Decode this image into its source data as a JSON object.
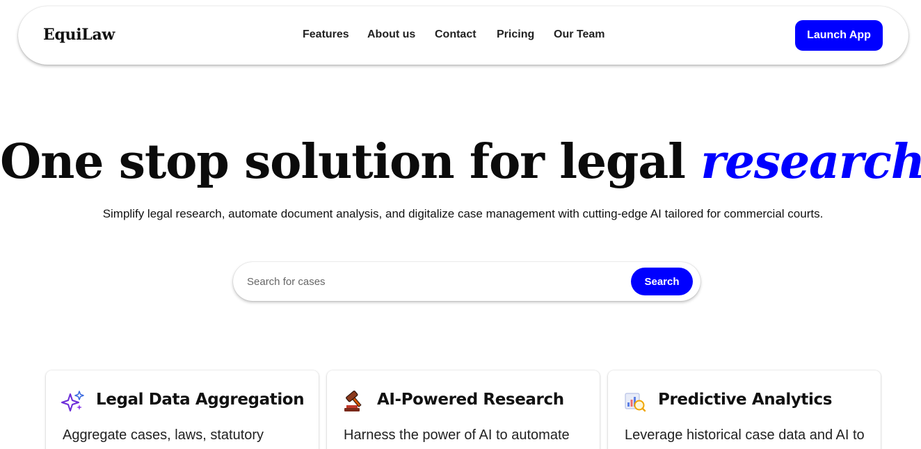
{
  "brand": {
    "name": "EquiLaw",
    "accent_color": "#0000ff"
  },
  "nav": {
    "items": [
      {
        "label": "Features"
      },
      {
        "label": "About us"
      },
      {
        "label": "Contact"
      },
      {
        "label": "Pricing"
      },
      {
        "label": "Our Team"
      }
    ],
    "cta_label": "Launch App"
  },
  "hero": {
    "title_main": "One stop solution for legal ",
    "title_accent": "research!",
    "subtitle": "Simplify legal research, automate document analysis, and digitalize case management with cutting-edge AI tailored for commercial courts."
  },
  "search": {
    "placeholder": "Search for cases",
    "value": "",
    "button_label": "Search"
  },
  "features": [
    {
      "icon": "sparkles-icon",
      "title": "Legal Data Aggregation",
      "description": "Aggregate cases, laws, statutory"
    },
    {
      "icon": "gavel-icon",
      "title": "AI-Powered Research",
      "description": "Harness the power of AI to automate"
    },
    {
      "icon": "analytics-icon",
      "title": "Predictive Analytics",
      "description": "Leverage historical case data and AI to"
    }
  ]
}
